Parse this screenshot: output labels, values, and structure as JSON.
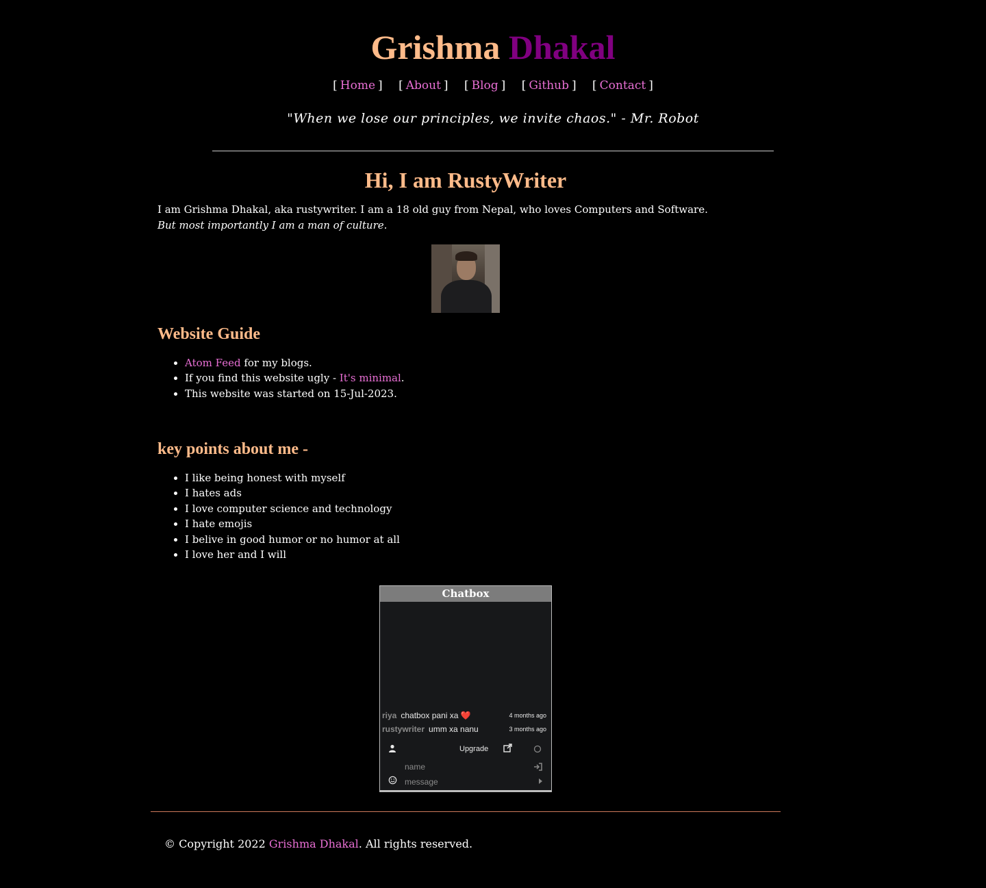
{
  "header": {
    "first_name": "Grishma",
    "last_name": "Dhakal",
    "quote": "\"When we lose our principles, we invite chaos.\" - Mr. Robot"
  },
  "nav": {
    "open_bracket": "[",
    "close_bracket": "]",
    "items": [
      {
        "label": "Home"
      },
      {
        "label": "About"
      },
      {
        "label": "Blog"
      },
      {
        "label": "Github"
      },
      {
        "label": "Contact"
      }
    ]
  },
  "hero": {
    "heading": "Hi, I am RustyWriter",
    "intro": "I am Grishma Dhakal, aka rustywriter. I am a 18 old guy from Nepal, who loves Computers and Software.",
    "intro_italic": "But most importantly I am a man of culture."
  },
  "guide": {
    "heading": "Website Guide",
    "items": [
      {
        "link": "Atom Feed",
        "text": " for my blogs."
      },
      {
        "text": "If you find this website ugly - ",
        "link": "It's minimal",
        "after": "."
      },
      {
        "text": "This website was started on 15-Jul-2023."
      }
    ]
  },
  "keypoints": {
    "heading": "key points about me -",
    "items": [
      "I like being honest with myself",
      "I hates ads",
      "I love computer science and technology",
      "I hate emojis",
      "I belive in good humor or no humor at all",
      "I love her and I will"
    ]
  },
  "chatbox": {
    "title": "Chatbox",
    "messages": [
      {
        "user": "riya",
        "text": "chatbox pani xa ❤️",
        "time": "4 months ago"
      },
      {
        "user": "rustywriter",
        "text": "umm xa nanu",
        "time": "3 months ago"
      }
    ],
    "upgrade_label": "Upgrade",
    "name_placeholder": "name",
    "message_placeholder": "message"
  },
  "footer": {
    "prefix": "© Copyright 2022 ",
    "link": "Grishma Dhakal",
    "suffix": ". All rights reserved."
  },
  "colors": {
    "accent_peach": "#ffbb8a",
    "accent_purple": "#800080",
    "link_pink": "#e86fd4",
    "background": "#000000"
  }
}
